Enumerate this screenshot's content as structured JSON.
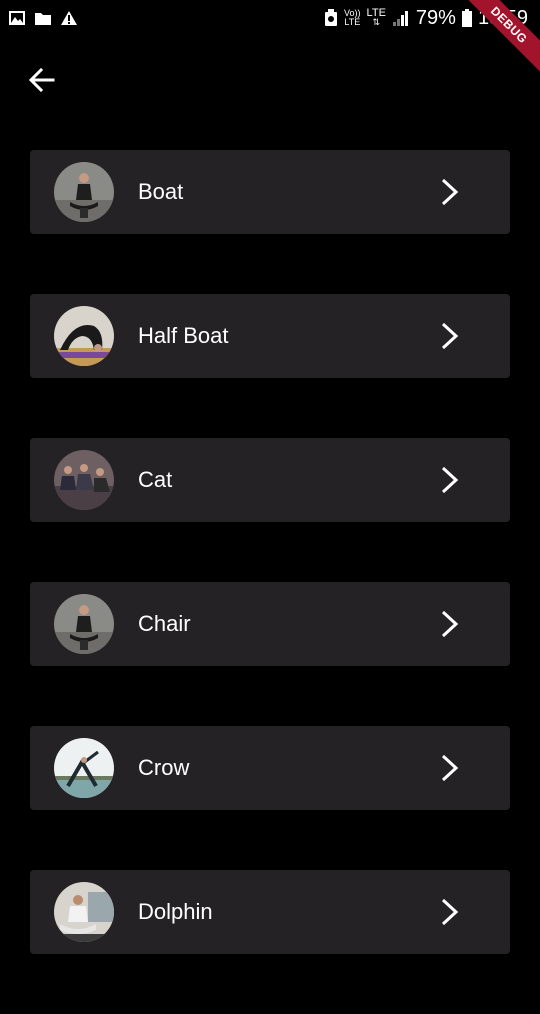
{
  "status_bar": {
    "network_small_top": "Vo))",
    "network_small_bottom": "LTE",
    "lte_label": "LTE",
    "battery_percent": "79%",
    "time": "15:59",
    "icons": [
      "image-icon",
      "folder-icon",
      "warning-icon",
      "recycle-icon",
      "signal-icon",
      "battery-icon"
    ]
  },
  "debug_banner": "DEBUG",
  "app_bar": {
    "back_icon": "arrow-left-icon"
  },
  "poses": [
    {
      "label": "Boat",
      "avatar": "meditation-pose-photo"
    },
    {
      "label": "Half Boat",
      "avatar": "backbend-pose-photo"
    },
    {
      "label": "Cat",
      "avatar": "group-class-photo"
    },
    {
      "label": "Chair",
      "avatar": "meditation-pose-photo"
    },
    {
      "label": "Crow",
      "avatar": "triangle-pose-photo"
    },
    {
      "label": "Dolphin",
      "avatar": "lotus-pose-photo"
    }
  ],
  "colors": {
    "background": "#000000",
    "card": "#252226",
    "text": "#ffffff",
    "debug_ribbon": "#a1142b"
  }
}
